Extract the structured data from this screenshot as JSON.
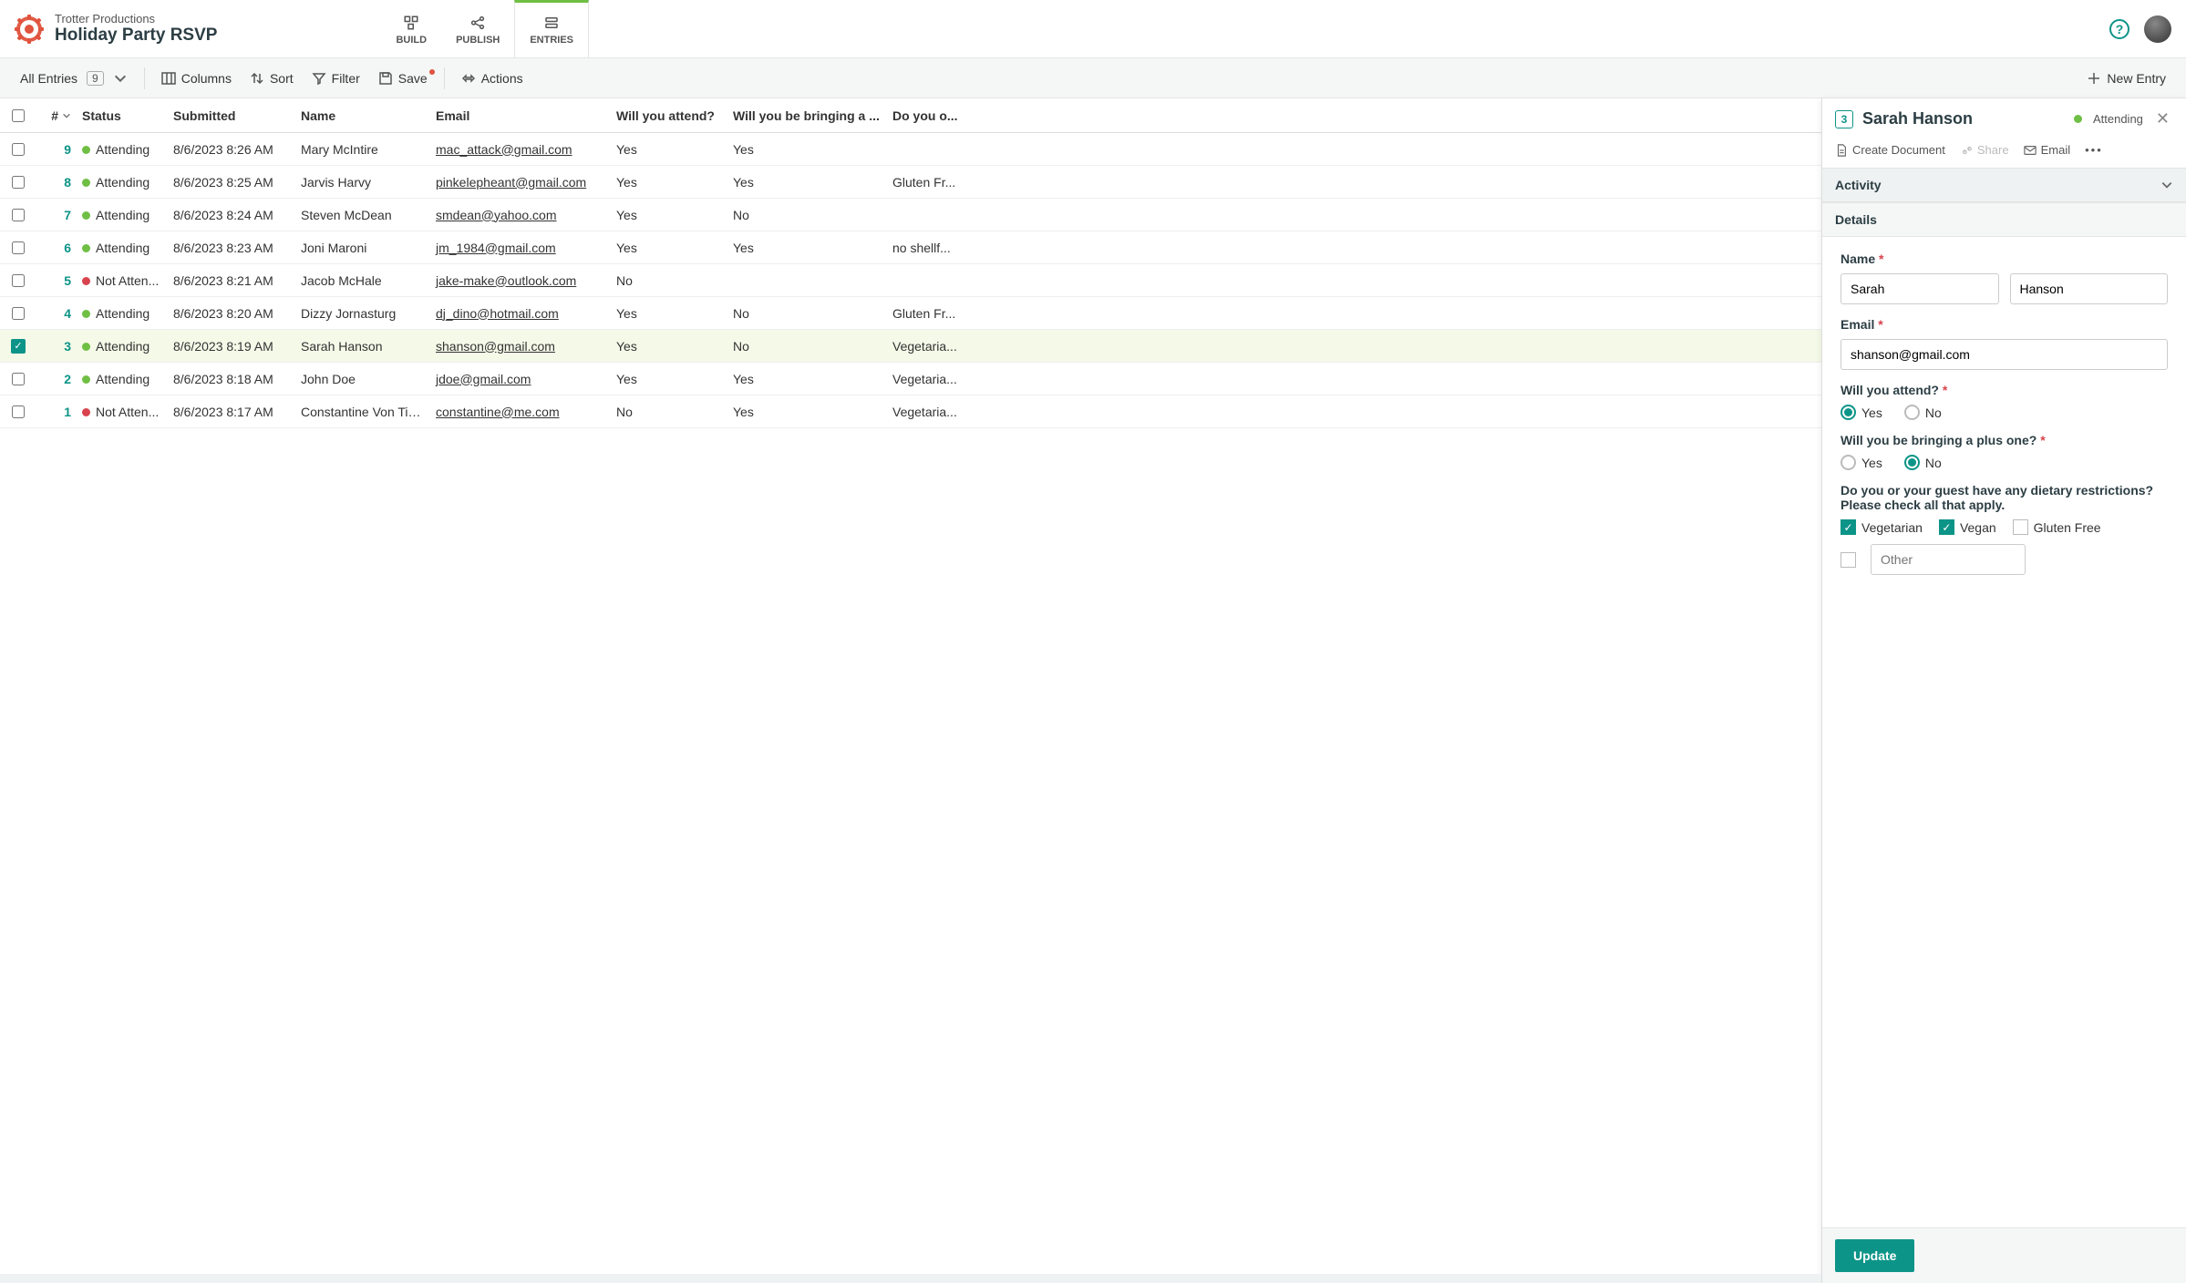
{
  "header": {
    "org": "Trotter Productions",
    "title": "Holiday Party RSVP",
    "tabs": {
      "build": "BUILD",
      "publish": "PUBLISH",
      "entries": "ENTRIES"
    }
  },
  "toolbar": {
    "allEntries": "All Entries",
    "count": "9",
    "columns": "Columns",
    "sort": "Sort",
    "filter": "Filter",
    "save": "Save",
    "actions": "Actions",
    "newEntry": "New Entry"
  },
  "columns": {
    "num": "#",
    "status": "Status",
    "submitted": "Submitted",
    "name": "Name",
    "email": "Email",
    "attend": "Will you attend?",
    "plusOne": "Will you be bringing a ...",
    "dietary": "Do you o..."
  },
  "rows": [
    {
      "n": "9",
      "statusColor": "green",
      "status": "Attending",
      "submitted": "8/6/2023 8:26 AM",
      "name": "Mary McIntire",
      "email": "mac_attack@gmail.com",
      "attend": "Yes",
      "plus": "Yes",
      "diet": "",
      "selected": false
    },
    {
      "n": "8",
      "statusColor": "green",
      "status": "Attending",
      "submitted": "8/6/2023 8:25 AM",
      "name": "Jarvis Harvy",
      "email": "pinkelepheant@gmail.com",
      "attend": "Yes",
      "plus": "Yes",
      "diet": "Gluten Fr...",
      "selected": false
    },
    {
      "n": "7",
      "statusColor": "green",
      "status": "Attending",
      "submitted": "8/6/2023 8:24 AM",
      "name": "Steven McDean",
      "email": "smdean@yahoo.com",
      "attend": "Yes",
      "plus": "No",
      "diet": "",
      "selected": false
    },
    {
      "n": "6",
      "statusColor": "green",
      "status": "Attending",
      "submitted": "8/6/2023 8:23 AM",
      "name": "Joni Maroni",
      "email": "jm_1984@gmail.com",
      "attend": "Yes",
      "plus": "Yes",
      "diet": "no shellf...",
      "selected": false
    },
    {
      "n": "5",
      "statusColor": "red",
      "status": "Not Atten...",
      "submitted": "8/6/2023 8:21 AM",
      "name": "Jacob McHale",
      "email": "jake-make@outlook.com",
      "attend": "No",
      "plus": "",
      "diet": "",
      "selected": false
    },
    {
      "n": "4",
      "statusColor": "green",
      "status": "Attending",
      "submitted": "8/6/2023 8:20 AM",
      "name": "Dizzy Jornasturg",
      "email": "dj_dino@hotmail.com",
      "attend": "Yes",
      "plus": "No",
      "diet": "Gluten Fr...",
      "selected": false
    },
    {
      "n": "3",
      "statusColor": "green",
      "status": "Attending",
      "submitted": "8/6/2023 8:19 AM",
      "name": "Sarah Hanson",
      "email": "shanson@gmail.com",
      "attend": "Yes",
      "plus": "No",
      "diet": "Vegetaria...",
      "selected": true
    },
    {
      "n": "2",
      "statusColor": "green",
      "status": "Attending",
      "submitted": "8/6/2023 8:18 AM",
      "name": "John Doe",
      "email": "jdoe@gmail.com",
      "attend": "Yes",
      "plus": "Yes",
      "diet": "Vegetaria...",
      "selected": false
    },
    {
      "n": "1",
      "statusColor": "red",
      "status": "Not Atten...",
      "submitted": "8/6/2023 8:17 AM",
      "name": "Constantine Von Tis...",
      "email": "constantine@me.com",
      "attend": "No",
      "plus": "Yes",
      "diet": "Vegetaria...",
      "selected": false
    }
  ],
  "panel": {
    "num": "3",
    "title": "Sarah Hanson",
    "status": "Attending",
    "actions": {
      "createDoc": "Create Document",
      "share": "Share",
      "email": "Email"
    },
    "sections": {
      "activity": "Activity",
      "details": "Details"
    },
    "form": {
      "nameLabel": "Name",
      "first": "Sarah",
      "last": "Hanson",
      "emailLabel": "Email",
      "email": "shanson@gmail.com",
      "attendLabel": "Will you attend?",
      "yes": "Yes",
      "no": "No",
      "plusLabel": "Will you be bringing a plus one?",
      "dietLabel": "Do you or your guest have any dietary restrictions? Please check all that apply.",
      "vegetarian": "Vegetarian",
      "vegan": "Vegan",
      "glutenFree": "Gluten Free",
      "otherPlaceholder": "Other"
    },
    "update": "Update"
  }
}
